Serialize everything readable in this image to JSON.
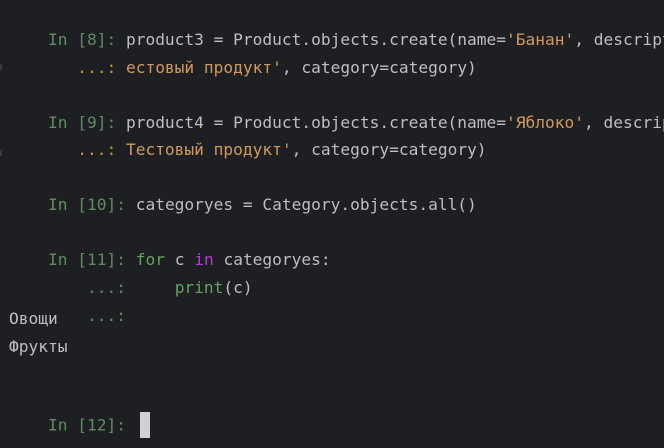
{
  "cells": [
    {
      "in_label": "In [8]: ",
      "code": "product3 = Product.objects.create(name=",
      "str1": "'Банан'",
      "tail": ", descriptio",
      "cont_label": "   ...: ",
      "cont_str": "естовый продукт'",
      "cont_tail": ", category=category)"
    },
    {
      "in_label": "In [9]: ",
      "code": "product4 = Product.objects.create(name=",
      "str1": "'Яблоко'",
      "tail": ", descriptio",
      "cont_label": "   ...: ",
      "cont_str": "Тестовый продукт'",
      "cont_tail": ", category=category)"
    },
    {
      "in_label": "In [10]: ",
      "code": "categoryes = Category.objects.all()"
    },
    {
      "in_label": "In [11]: ",
      "kw_for": "for",
      "c1": " c ",
      "kw_in": "in",
      "c2": " categoryes:",
      "cont1_label": "    ...:     ",
      "print_fn": "print",
      "print_args": "(c)",
      "cont2_label": "    ...: "
    }
  ],
  "outputs": [
    "Овощи",
    "Фрукты"
  ],
  "current_prompt": "In [12]: "
}
